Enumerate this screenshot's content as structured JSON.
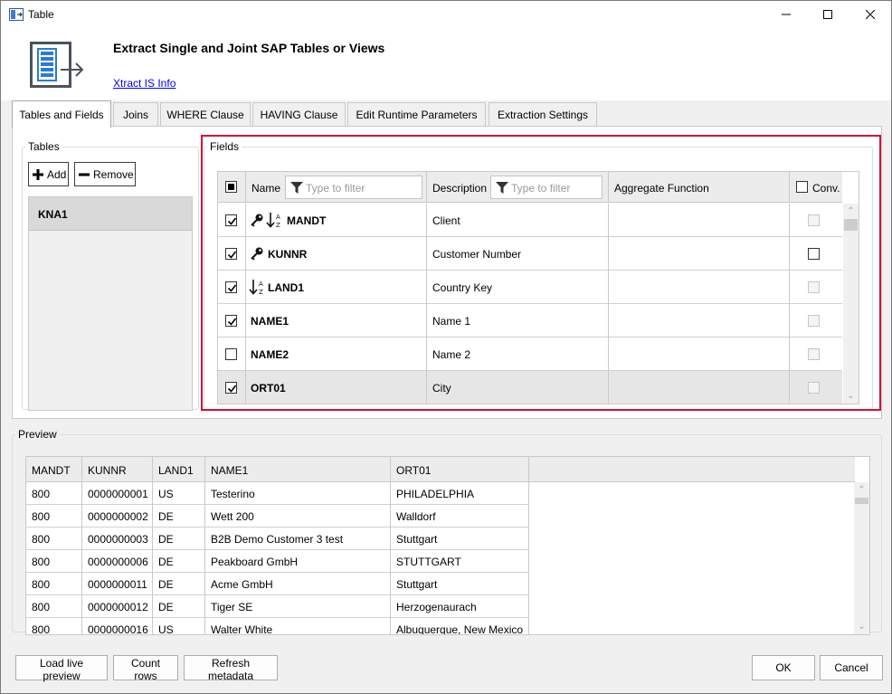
{
  "window": {
    "title": "Table"
  },
  "header": {
    "title": "Extract Single and Joint SAP Tables or Views",
    "info_link": "Xtract IS Info"
  },
  "tabs": [
    {
      "label": "Tables and Fields",
      "active": true
    },
    {
      "label": "Joins"
    },
    {
      "label": "WHERE Clause"
    },
    {
      "label": "HAVING Clause"
    },
    {
      "label": "Edit Runtime Parameters"
    },
    {
      "label": "Extraction Settings"
    }
  ],
  "tables_group": {
    "legend": "Tables",
    "add_label": "Add",
    "remove_label": "Remove",
    "items": [
      "KNA1"
    ]
  },
  "fields_group": {
    "legend": "Fields",
    "columns": {
      "name": "Name",
      "description": "Description",
      "aggregate": "Aggregate Function",
      "conv": "Conv."
    },
    "filter_placeholder": "Type to filter",
    "rows": [
      {
        "checked": true,
        "name": "MANDT",
        "key": true,
        "sorted": true,
        "description": "Client",
        "conv_enabled": false
      },
      {
        "checked": true,
        "name": "KUNNR",
        "key": true,
        "sorted": false,
        "description": "Customer Number",
        "conv_enabled": true
      },
      {
        "checked": true,
        "name": "LAND1",
        "key": false,
        "sorted": true,
        "description": "Country Key",
        "conv_enabled": false
      },
      {
        "checked": true,
        "name": "NAME1",
        "key": false,
        "sorted": false,
        "description": "Name 1",
        "conv_enabled": false
      },
      {
        "checked": false,
        "name": "NAME2",
        "key": false,
        "sorted": false,
        "description": "Name 2",
        "conv_enabled": false
      },
      {
        "checked": true,
        "name": "ORT01",
        "key": false,
        "sorted": false,
        "description": "City",
        "conv_enabled": false,
        "selected": true
      }
    ]
  },
  "preview": {
    "legend": "Preview",
    "columns": [
      "MANDT",
      "KUNNR",
      "LAND1",
      "NAME1",
      "ORT01"
    ],
    "rows": [
      [
        "800",
        "0000000001",
        "US",
        "Testerino",
        "PHILADELPHIA"
      ],
      [
        "800",
        "0000000002",
        "DE",
        "Wett 200",
        "Walldorf"
      ],
      [
        "800",
        "0000000003",
        "DE",
        "B2B Demo Customer 3 test",
        "Stuttgart"
      ],
      [
        "800",
        "0000000006",
        "DE",
        "Peakboard GmbH",
        "STUTTGART"
      ],
      [
        "800",
        "0000000011",
        "DE",
        "Acme GmbH",
        "Stuttgart"
      ],
      [
        "800",
        "0000000012",
        "DE",
        "Tiger SE",
        "Herzogenaurach"
      ],
      [
        "800",
        "0000000016",
        "US",
        "Walter White",
        "Albuquerque, New Mexico"
      ]
    ]
  },
  "footer": {
    "load_preview": "Load live preview",
    "count_rows": "Count rows",
    "refresh_metadata": "Refresh metadata",
    "ok": "OK",
    "cancel": "Cancel"
  },
  "colors": {
    "highlight_border": "#d0103a",
    "link": "#0000ee"
  }
}
